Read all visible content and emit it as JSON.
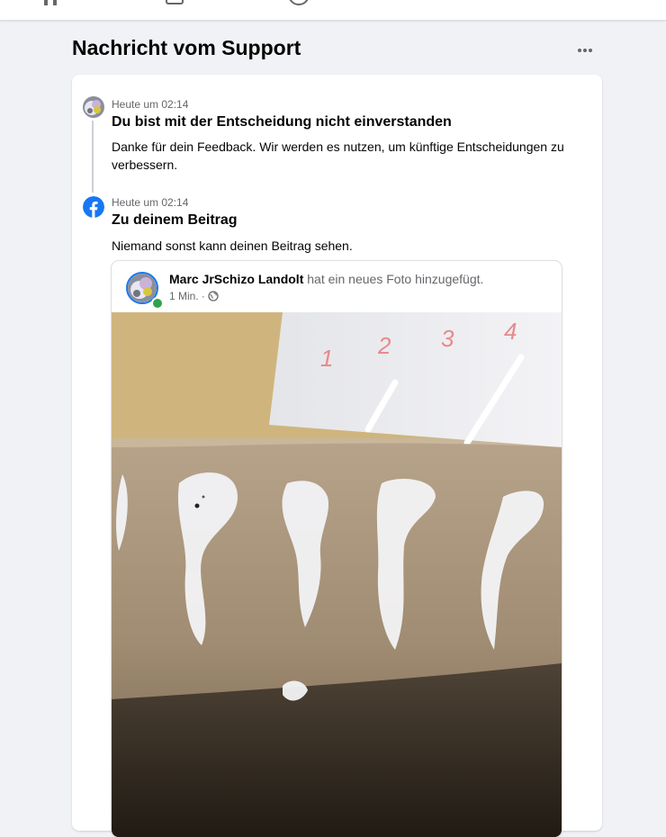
{
  "header": {
    "title": "Nachricht vom Support"
  },
  "messages": [
    {
      "time": "Heute um 02:14",
      "title": "Du bist mit der Entscheidung nicht einverstanden",
      "body": "Danke für dein Feedback. Wir werden es nutzen, um künftige Entscheidungen zu verbessern.",
      "icon": "user-avatar"
    },
    {
      "time": "Heute um 02:14",
      "title": "Zu deinem Beitrag",
      "body": "Niemand sonst kann deinen Beitrag sehen.",
      "icon": "facebook-logo-icon"
    }
  ],
  "post": {
    "author": "Marc JrSchizo Landolt",
    "action": "hat ein neues Foto hinzugefügt.",
    "time": "1 Min.",
    "separator": "·",
    "privacy_icon": "globe-icon",
    "photo_marks": [
      "1",
      "2",
      "3",
      "4"
    ]
  },
  "colors": {
    "facebook_blue": "#1877f2",
    "online_green": "#31a24c",
    "secondary_text": "#65676b",
    "background": "#f0f2f5"
  }
}
